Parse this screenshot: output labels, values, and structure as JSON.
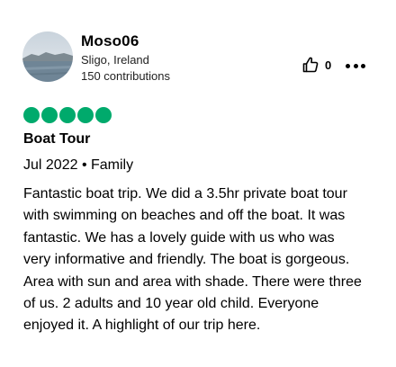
{
  "reviewer": {
    "username": "Moso06",
    "location": "Sligo, Ireland",
    "contributions": "150 contributions"
  },
  "actions": {
    "helpful_icon": "thumbs-up-icon",
    "helpful_count": "0",
    "more_icon": "more-dots-icon"
  },
  "rating": {
    "value": 5,
    "max": 5,
    "color": "#00aa6c"
  },
  "review": {
    "title": "Boat Tour",
    "meta": "Jul 2022 • Family",
    "text": "Fantastic boat trip. We did a 3.5hr private boat tour with swimming on beaches and off the boat. It was fantastic. We has a lovely guide with us who was very informative and friendly. The boat is gorgeous. Area with sun and area with shade. There were three of us. 2 adults and 10 year old child. Everyone enjoyed it. A highlight of our trip here."
  }
}
